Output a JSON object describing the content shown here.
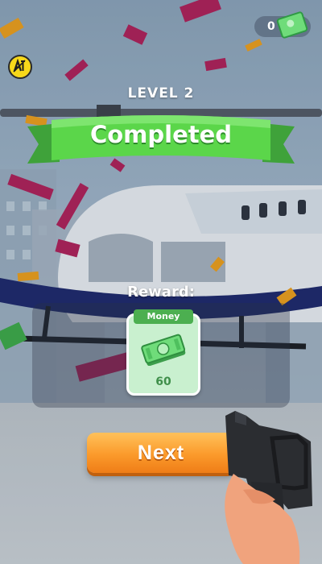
{
  "hud": {
    "coin_count": "0",
    "money_icon": "money-stack-icon",
    "no_ads_icon": "no-ads-icon"
  },
  "level": {
    "label": "LEVEL 2",
    "status": "Completed"
  },
  "reward": {
    "label": "Reward:",
    "card_title": "Money",
    "amount": "60"
  },
  "actions": {
    "next_label": "Next"
  },
  "colors": {
    "banner_green": "#5bd64a",
    "button_orange": "#fb9a2b",
    "coin_badge_yellow": "#f7d81a"
  }
}
